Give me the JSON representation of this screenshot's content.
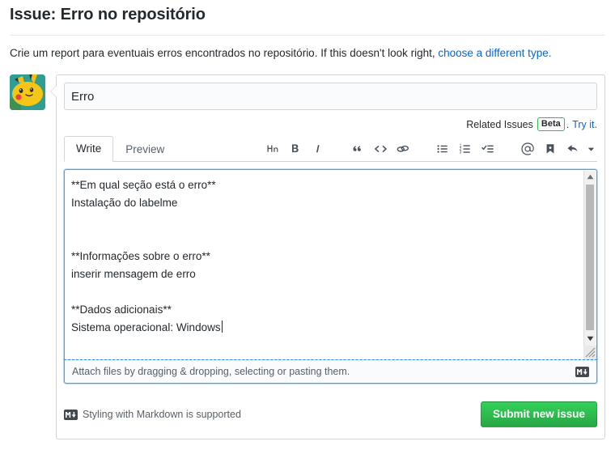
{
  "header": {
    "title": "Issue: Erro no repositório",
    "description_prefix": "Crie um report para eventuais erros encontrados no repositório. If this doesn't look right, ",
    "description_link": "choose a different type.",
    "link_color": "#0366d6"
  },
  "avatar": {
    "name": "user-avatar",
    "alt": "pikachu-avatar"
  },
  "issue_title": {
    "value": "Erro",
    "placeholder": "Title"
  },
  "related_issues": {
    "label": "Related Issues",
    "badge": "Beta",
    "separator": ".",
    "action": "Try it.",
    "badge_color": "#2cbe4e"
  },
  "tabs": [
    {
      "label": "Write",
      "selected": true
    },
    {
      "label": "Preview",
      "selected": false
    }
  ],
  "toolbar": {
    "left_group": [
      {
        "name": "heading-icon",
        "title": "Add header text"
      },
      {
        "name": "bold-icon",
        "title": "Add bold text"
      },
      {
        "name": "italic-icon",
        "title": "Add italic text"
      },
      {
        "name": "quote-icon",
        "title": "Insert a quote"
      },
      {
        "name": "code-icon",
        "title": "Insert code"
      },
      {
        "name": "link-icon",
        "title": "Add a link"
      }
    ],
    "right_group": [
      {
        "name": "unordered-list-icon",
        "title": "Add a bulleted list"
      },
      {
        "name": "ordered-list-icon",
        "title": "Add a numbered list"
      },
      {
        "name": "task-list-icon",
        "title": "Add a task list"
      },
      {
        "name": "mention-icon",
        "title": "Directly mention a user or team"
      },
      {
        "name": "saved-reply-icon",
        "title": "Reference an issue, pull request, or discussion"
      },
      {
        "name": "reply-icon",
        "title": "Add saved reply"
      }
    ]
  },
  "editor": {
    "content": "**Em qual seção está o erro**\nInstalação do labelme\n\n\n**Informações sobre o erro**\ninserir mensagem de erro\n\n**Dados adicionais**\nSistema operacional: Windows",
    "focused": true,
    "border_color": "#4a9eea"
  },
  "attach": {
    "text": "Attach files by dragging & dropping, selecting or pasting them.",
    "markdown_icon": "markdown-icon"
  },
  "footer": {
    "markdown_note": "Styling with Markdown is supported",
    "markdown_icon": "markdown-icon",
    "submit_label": "Submit new issue",
    "submit_color": "#28a745"
  }
}
